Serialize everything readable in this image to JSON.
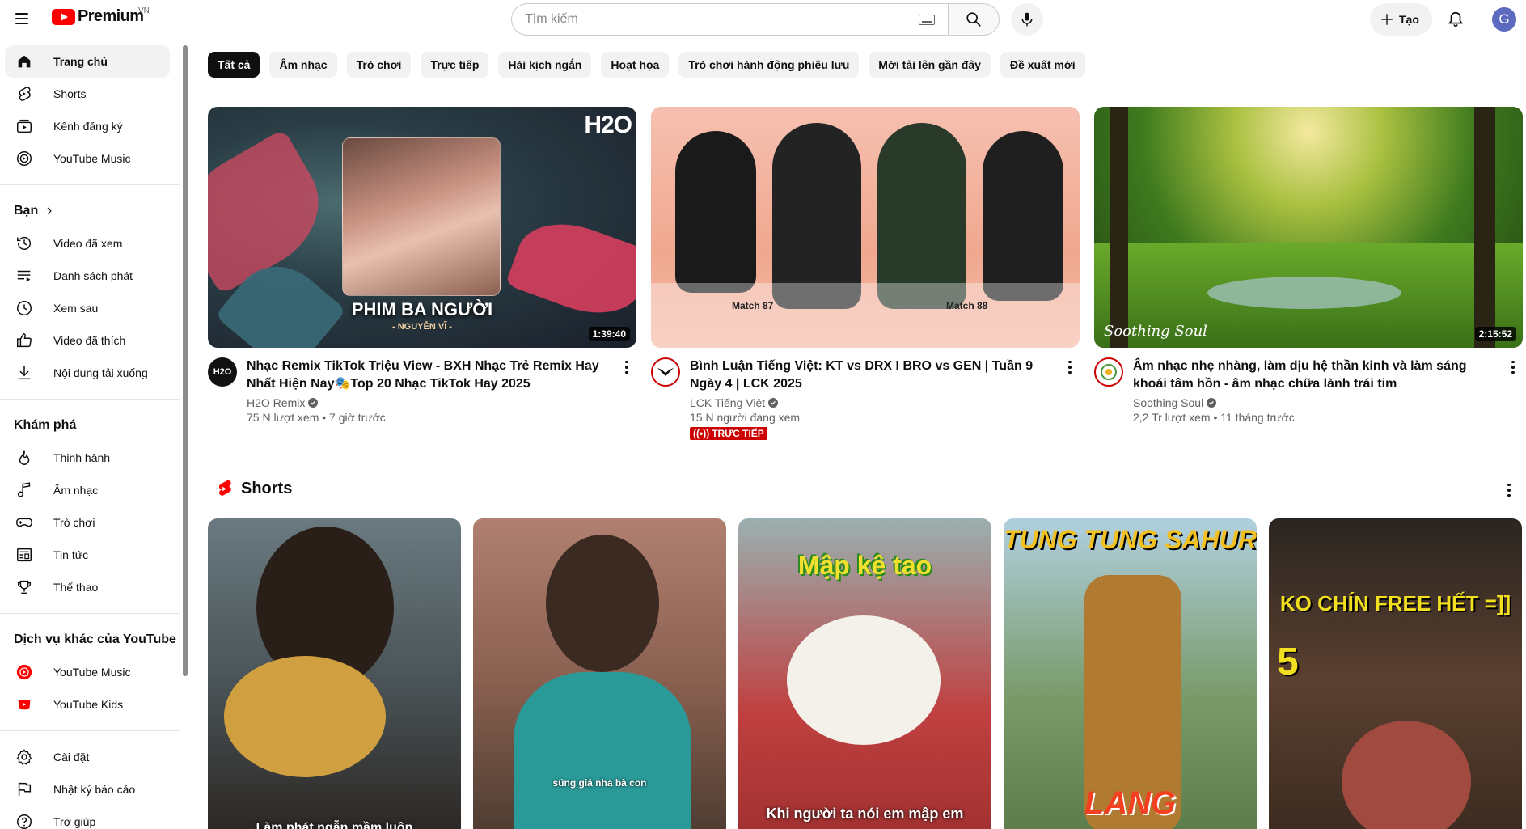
{
  "header": {
    "logo_text": "Premium",
    "region": "VN",
    "search_placeholder": "Tìm kiếm",
    "create_label": "Tạo",
    "avatar_letter": "G"
  },
  "sidebar": {
    "main": [
      {
        "label": "Trang chủ",
        "icon": "home-icon",
        "active": true
      },
      {
        "label": "Shorts",
        "icon": "shorts-icon"
      },
      {
        "label": "Kênh đăng ký",
        "icon": "subscriptions-icon"
      },
      {
        "label": "YouTube Music",
        "icon": "youtube-music-icon"
      }
    ],
    "you_heading": "Bạn",
    "you": [
      {
        "label": "Video đã xem",
        "icon": "history-icon"
      },
      {
        "label": "Danh sách phát",
        "icon": "playlists-icon"
      },
      {
        "label": "Xem sau",
        "icon": "watch-later-icon"
      },
      {
        "label": "Video đã thích",
        "icon": "like-icon"
      },
      {
        "label": "Nội dung tải xuống",
        "icon": "download-icon"
      }
    ],
    "explore_heading": "Khám phá",
    "explore": [
      {
        "label": "Thịnh hành",
        "icon": "trending-icon"
      },
      {
        "label": "Âm nhạc",
        "icon": "music-icon"
      },
      {
        "label": "Trò chơi",
        "icon": "gaming-icon"
      },
      {
        "label": "Tin tức",
        "icon": "news-icon"
      },
      {
        "label": "Thể thao",
        "icon": "trophy-icon"
      }
    ],
    "more_heading": "Dịch vụ khác của YouTube",
    "more": [
      {
        "label": "YouTube Music",
        "icon": "youtube-music-red-icon"
      },
      {
        "label": "YouTube Kids",
        "icon": "youtube-kids-icon"
      }
    ],
    "settings": [
      {
        "label": "Cài đặt",
        "icon": "gear-icon"
      },
      {
        "label": "Nhật ký báo cáo",
        "icon": "flag-icon"
      },
      {
        "label": "Trợ giúp",
        "icon": "help-icon"
      }
    ]
  },
  "chips": [
    "Tất cả",
    "Âm nhạc",
    "Trò chơi",
    "Trực tiếp",
    "Hài kịch ngắn",
    "Hoạt họa",
    "Trò chơi hành động phiêu lưu",
    "Mới tải lên gần đây",
    "Đề xuất mới"
  ],
  "videos": [
    {
      "title": "Nhạc Remix TikTok Triệu View - BXH Nhạc Trẻ Remix Hay Nhất Hiện Nay🎭Top 20 Nhạc TikTok Hay 2025",
      "channel": "H2O Remix",
      "stats": "75 N lượt xem • 7 giờ trước",
      "duration": "1:39:40",
      "thumb_text": "PHIM BA NGƯỜI",
      "thumb_sub": "- NGUYỄN VĨ -",
      "thumb_logo": "H2O",
      "avatar_text": "H2O"
    },
    {
      "title": "Bình Luận Tiếng Việt: KT vs DRX I BRO vs GEN | Tuần 9 Ngày 4 | LCK 2025",
      "channel": "LCK Tiếng Việt",
      "stats": "15 N người đang xem",
      "live_label": "TRỰC TIẾP",
      "thumb_match1": "Match 87",
      "thumb_match2": "Match 88"
    },
    {
      "title": "Âm nhạc nhẹ nhàng, làm dịu hệ thần kinh và làm sáng khoái tâm hồn - âm nhạc chữa lành trái tim",
      "channel": "Soothing Soul",
      "stats": "2,2 Tr lượt xem • 11 tháng trước",
      "duration": "2:15:52",
      "thumb_sig": "Soothing Soul"
    }
  ],
  "shorts": {
    "heading": "Shorts",
    "items": [
      {
        "caption": "Làm phát ngẫn mầm luôn"
      },
      {
        "caption": "súng giả nha bà con"
      },
      {
        "caption": "Mập kệ tao",
        "caption2": "Khi người ta nói em mập em"
      },
      {
        "caption": "TUNG TUNG SAHUR",
        "caption2": "LANG"
      },
      {
        "caption": "KO CHÍN FREE HẾT =]]",
        "caption2": "5"
      }
    ]
  }
}
